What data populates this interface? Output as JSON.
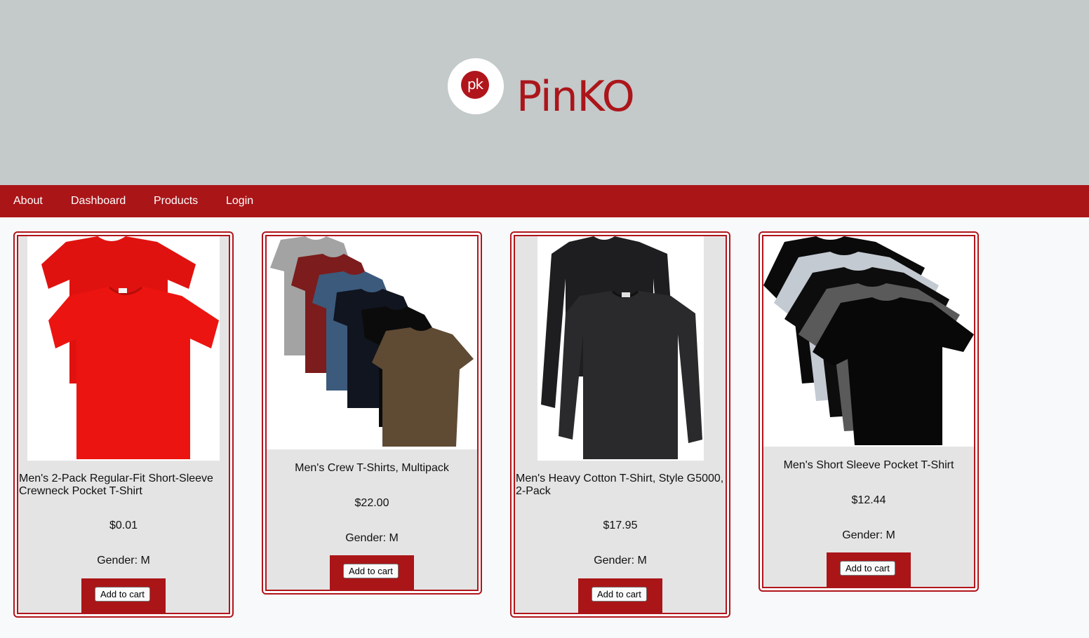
{
  "brand": {
    "name": "PinKO",
    "logo_text": "pk"
  },
  "nav": {
    "items": [
      "About",
      "Dashboard",
      "Products",
      "Login"
    ]
  },
  "products": [
    {
      "title": "Men's 2-Pack Regular-Fit Short-Sleeve Crewneck Pocket T-Shirt",
      "price": "$0.01",
      "gender": "Gender: M",
      "button": "Add to cart",
      "image": "red-tshirts-image"
    },
    {
      "title": "Men's Crew T-Shirts, Multipack",
      "price": "$22.00",
      "gender": "Gender: M",
      "button": "Add to cart",
      "image": "multicolor-tshirts-image"
    },
    {
      "title": "Men's Heavy Cotton T-Shirt, Style G5000, 2-Pack",
      "price": "$17.95",
      "gender": "Gender: M",
      "button": "Add to cart",
      "image": "black-longsleeve-image"
    },
    {
      "title": "Men's Short Sleeve Pocket T-Shirt",
      "price": "$12.44",
      "gender": "Gender: M",
      "button": "Add to cart",
      "image": "grey-black-tshirts-image"
    }
  ],
  "colors": {
    "brand_red": "#aa1518",
    "header_bg": "#c4c9ca",
    "card_bg": "#e5e4e4"
  }
}
